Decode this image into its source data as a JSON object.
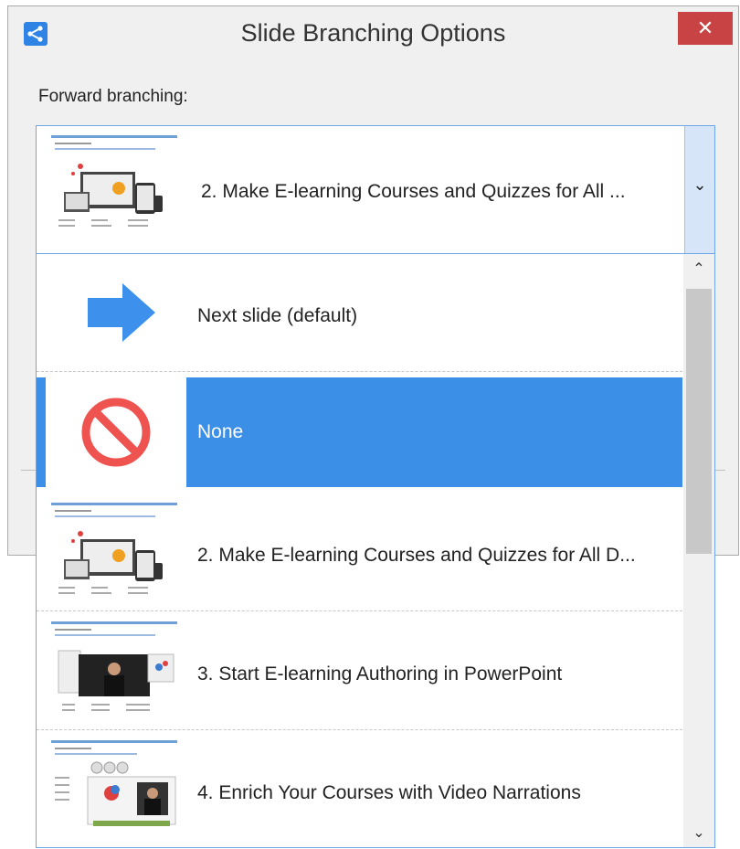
{
  "window": {
    "title": "Slide Branching Options",
    "close_glyph": "✕"
  },
  "form": {
    "forward_label": "Forward branching:"
  },
  "combo": {
    "selected_text": "2. Make E-learning Courses and Quizzes for All ...",
    "arrow_glyph": "⌄"
  },
  "dropdown": {
    "items": [
      {
        "label": "Next slide (default)",
        "icon": "arrow-right-icon"
      },
      {
        "label": "None",
        "icon": "no-entry-icon",
        "selected": true
      },
      {
        "label": "2. Make E-learning Courses and Quizzes for All D...",
        "icon": "slide-thumbnail"
      },
      {
        "label": "3. Start E-learning Authoring in PowerPoint",
        "icon": "slide-thumbnail"
      },
      {
        "label": "4. Enrich Your Courses with Video Narrations",
        "icon": "slide-thumbnail"
      }
    ],
    "scroll_up_glyph": "⌃",
    "scroll_down_glyph": "⌄"
  },
  "colors": {
    "selection": "#3b8fe6",
    "accent_blue": "#2f83e4",
    "no_entry_red": "#ef5350",
    "close_red": "#c84444"
  }
}
